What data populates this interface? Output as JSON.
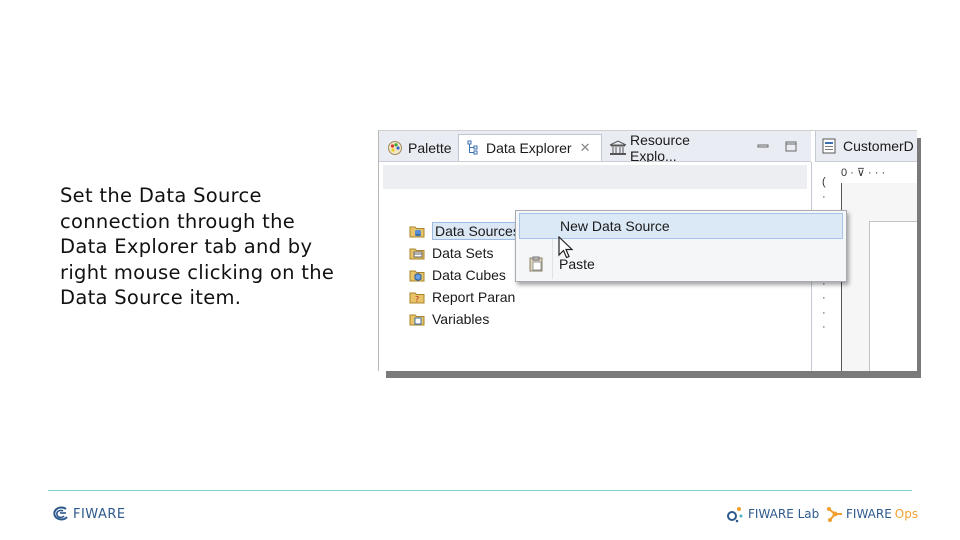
{
  "caption": {
    "line1": "Set the Data Source",
    "line2": "connection through the",
    "line3": "Data Explorer tab  and by",
    "line4": "right mouse clicking on the",
    "line5": "Data Source item."
  },
  "eclipse": {
    "tabs": [
      {
        "label": "Palette",
        "icon": "palette-icon"
      },
      {
        "label": "Data Explorer",
        "icon": "data-explorer-icon",
        "active": true
      },
      {
        "label": "Resource Explo...",
        "icon": "resource-explorer-icon"
      }
    ],
    "editor_tab": {
      "label": "CustomerD"
    },
    "tree": [
      {
        "label": "Data Sources",
        "icon": "data-sources-icon",
        "selected": true
      },
      {
        "label": "Data Sets",
        "icon": "data-sets-icon"
      },
      {
        "label": "Data Cubes",
        "icon": "data-cubes-icon"
      },
      {
        "label": "Report Paran",
        "icon": "report-parameters-icon"
      },
      {
        "label": "Variables",
        "icon": "variables-icon"
      }
    ],
    "ruler_h": "0 · ⊽ · · ·",
    "ruler_v": "( · · · · · 1 · · · ·"
  },
  "context_menu": {
    "items": [
      {
        "label": "New Data Source",
        "hover": true
      },
      {
        "label": "Paste",
        "icon": "clipboard-icon"
      }
    ]
  },
  "footer": {
    "logo_fiware": "FIWARE",
    "logo_lab": "FIWARE Lab",
    "logo_ops_main": "FIWARE",
    "logo_ops_suffix": "Ops"
  },
  "colors": {
    "selection_bg": "#dce8f6",
    "footer_rule": "#7fd0d6",
    "logo_blue": "#2d5a8c",
    "ops_orange": "#f0a030"
  }
}
